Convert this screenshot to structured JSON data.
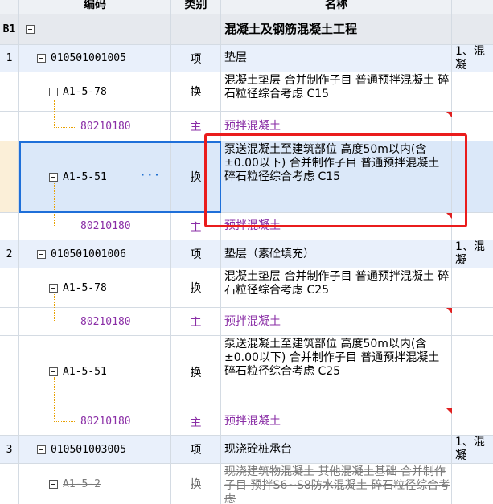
{
  "header": {
    "code": "编码",
    "category": "类别",
    "name": "名称"
  },
  "rows": [
    {
      "no": "B1",
      "code": "",
      "tag": "",
      "name": "混凝土及钢筋混凝土工程",
      "feature": ""
    },
    {
      "no": "1",
      "code": "010501001005",
      "tag": "项",
      "name": "垫层",
      "feature": "1、混凝"
    },
    {
      "code": "A1-5-78",
      "tag": "换",
      "name": "混凝土垫层  合并制作子目 普通预拌混凝土 碎石粒径综合考虑 C15"
    },
    {
      "code": "80210180",
      "tag": "主",
      "name": "预拌混凝土"
    },
    {
      "code": "A1-5-51",
      "tag": "换",
      "name": "泵送混凝土至建筑部位 高度50m以内(含±0.00以下)  合并制作子目 普通预拌混凝土 碎石粒径综合考虑 C15",
      "more": "···"
    },
    {
      "code": "80210180",
      "tag": "主",
      "name": "预拌混凝土"
    },
    {
      "no": "2",
      "code": "010501001006",
      "tag": "项",
      "name": "垫层（素砼填充）",
      "feature": "1、混凝"
    },
    {
      "code": "A1-5-78",
      "tag": "换",
      "name": "混凝土垫层  合并制作子目 普通预拌混凝土 碎石粒径综合考虑 C25"
    },
    {
      "code": "80210180",
      "tag": "主",
      "name": "预拌混凝土"
    },
    {
      "code": "A1-5-51",
      "tag": "换",
      "name": "泵送混凝土至建筑部位 高度50m以内(含±0.00以下)  合并制作子目 普通预拌混凝土 碎石粒径综合考虑 C25"
    },
    {
      "code": "80210180",
      "tag": "主",
      "name": "预拌混凝土"
    },
    {
      "no": "3",
      "code": "010501003005",
      "tag": "项",
      "name": "现浇砼桩承台",
      "feature": "1、混凝"
    },
    {
      "code": "A1-5-2",
      "tag": "换",
      "name": "现浇建筑物混凝土 其他混凝土基础  合并制作子目 预拌S6~S8防水混凝土 碎石粒径综合考虑"
    }
  ],
  "colors": {
    "header_bg": "#eef1f5",
    "item_bg": "#e9f0fb",
    "selection": "#1e6fd9",
    "highlight_box": "#ea1c1c",
    "material_text": "#8a2ea6"
  }
}
